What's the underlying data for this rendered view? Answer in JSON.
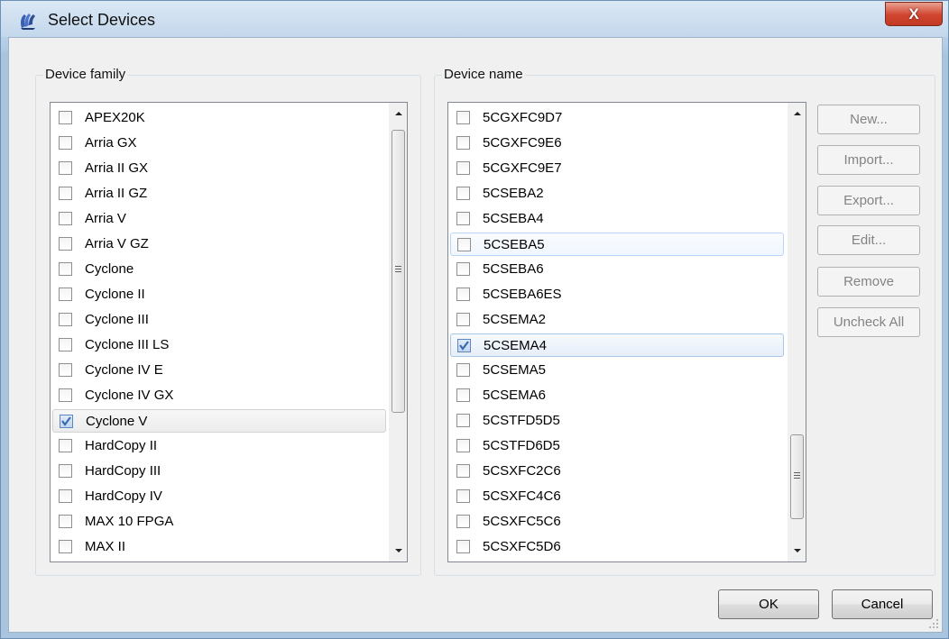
{
  "window": {
    "title": "Select Devices",
    "close_label": "X"
  },
  "device_family": {
    "label": "Device family",
    "items": [
      {
        "label": "APEX20K",
        "checked": false
      },
      {
        "label": "Arria GX",
        "checked": false
      },
      {
        "label": "Arria II GX",
        "checked": false
      },
      {
        "label": "Arria II GZ",
        "checked": false
      },
      {
        "label": "Arria V",
        "checked": false
      },
      {
        "label": "Arria V GZ",
        "checked": false
      },
      {
        "label": "Cyclone",
        "checked": false
      },
      {
        "label": "Cyclone II",
        "checked": false
      },
      {
        "label": "Cyclone III",
        "checked": false
      },
      {
        "label": "Cyclone III LS",
        "checked": false
      },
      {
        "label": "Cyclone IV E",
        "checked": false
      },
      {
        "label": "Cyclone IV GX",
        "checked": false
      },
      {
        "label": "Cyclone V",
        "checked": true
      },
      {
        "label": "HardCopy II",
        "checked": false
      },
      {
        "label": "HardCopy III",
        "checked": false
      },
      {
        "label": "HardCopy IV",
        "checked": false
      },
      {
        "label": "MAX 10 FPGA",
        "checked": false
      },
      {
        "label": "MAX II",
        "checked": false
      }
    ]
  },
  "device_name": {
    "label": "Device name",
    "items": [
      {
        "label": "5CGXFC9D7",
        "checked": false
      },
      {
        "label": "5CGXFC9E6",
        "checked": false
      },
      {
        "label": "5CGXFC9E7",
        "checked": false
      },
      {
        "label": "5CSEBA2",
        "checked": false
      },
      {
        "label": "5CSEBA4",
        "checked": false
      },
      {
        "label": "5CSEBA5",
        "checked": false
      },
      {
        "label": "5CSEBA6",
        "checked": false
      },
      {
        "label": "5CSEBA6ES",
        "checked": false
      },
      {
        "label": "5CSEMA2",
        "checked": false
      },
      {
        "label": "5CSEMA4",
        "checked": true
      },
      {
        "label": "5CSEMA5",
        "checked": false
      },
      {
        "label": "5CSEMA6",
        "checked": false
      },
      {
        "label": "5CSTFD5D5",
        "checked": false
      },
      {
        "label": "5CSTFD6D5",
        "checked": false
      },
      {
        "label": "5CSXFC2C6",
        "checked": false
      },
      {
        "label": "5CSXFC4C6",
        "checked": false
      },
      {
        "label": "5CSXFC5C6",
        "checked": false
      },
      {
        "label": "5CSXFC5D6",
        "checked": false
      }
    ]
  },
  "side_buttons": {
    "new": "New...",
    "import": "Import...",
    "export": "Export...",
    "edit": "Edit...",
    "remove": "Remove",
    "uncheck_all": "Uncheck All"
  },
  "footer": {
    "ok": "OK",
    "cancel": "Cancel"
  }
}
